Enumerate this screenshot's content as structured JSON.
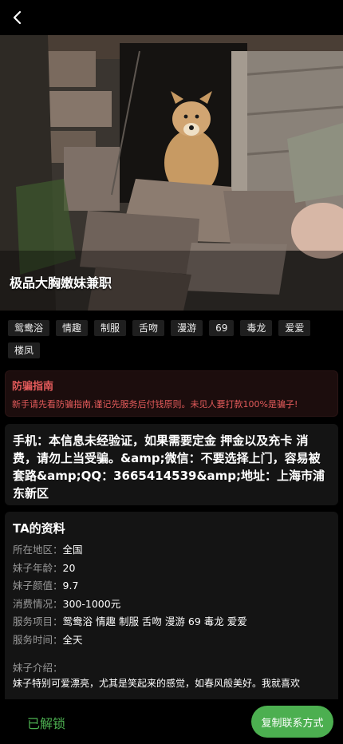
{
  "header": {
    "back_icon": "chevron-left-icon"
  },
  "hero": {
    "title": "极品大胸嫩妹兼职"
  },
  "tags": [
    "鸳鸯浴",
    "情趣",
    "制服",
    "舌吻",
    "漫游",
    "69",
    "毒龙",
    "爱爱",
    "楼凤"
  ],
  "warning": {
    "title": "防骗指南",
    "text": "新手请先看防骗指南,谨记先服务后付钱原则。未见人要打款100%是骗子!"
  },
  "contact": {
    "text": "手机：本信息未经验证，如果需要定金 押金以及充卡 消费，请勿上当受骗。&amp;微信：不要选择上门，容易被套路&amp;QQ：3665414539&amp;地址：上海市浦东新区"
  },
  "profile": {
    "title": "TA的资料",
    "rows": [
      {
        "label": "所在地区：",
        "value": "全国"
      },
      {
        "label": "妹子年龄：",
        "value": "20"
      },
      {
        "label": "妹子颜值：",
        "value": "9.7"
      },
      {
        "label": "消费情况：",
        "value": "300-1000元"
      },
      {
        "label": "服务项目：",
        "value": "鸳鸯浴 情趣 制服 舌吻 漫游 69 毒龙 爱爱"
      },
      {
        "label": "服务时间：",
        "value": "全天"
      }
    ],
    "intro_label": "妹子介绍：",
    "intro_text": "妹子特别可爱漂亮，尤其是笑起来的感觉，如春风般美好。我就喜欢"
  },
  "bottom": {
    "status": "已解锁",
    "copy_label": "复制联系方式"
  },
  "colors": {
    "accent": "#4caf50",
    "warning": "#e45b5b"
  }
}
